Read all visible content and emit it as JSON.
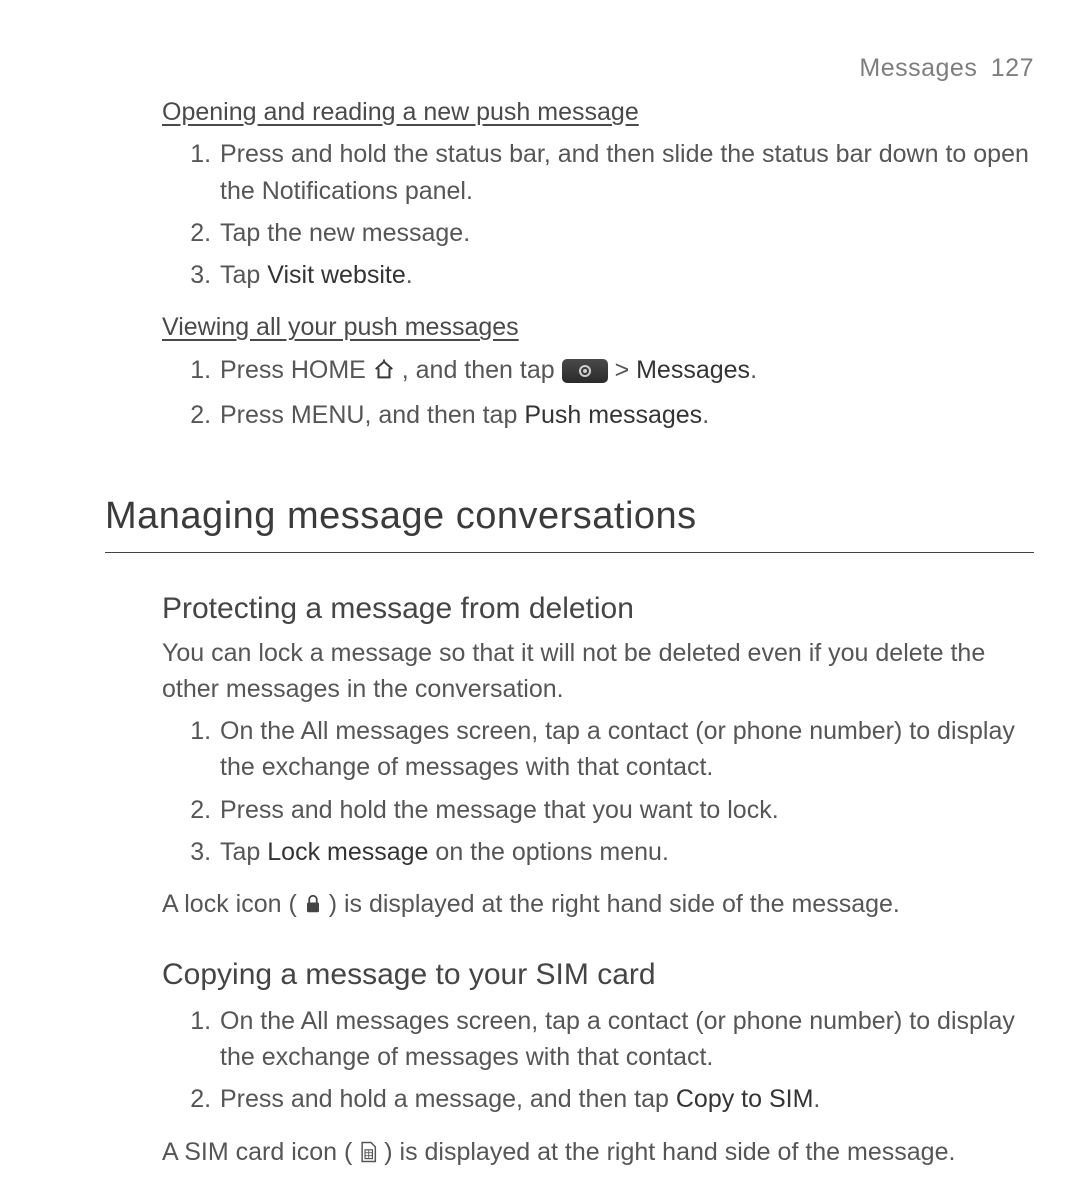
{
  "header": {
    "section": "Messages",
    "page_number": "127"
  },
  "sec1": {
    "sub1": "Opening and reading a new push message",
    "s1_1": "Press and hold the status bar, and then slide the status bar down to open the Notifications panel.",
    "s1_2": "Tap the new message.",
    "s1_3_a": "Tap ",
    "s1_3_b": "Visit website",
    "s1_3_c": ".",
    "sub2": "Viewing all your push messages",
    "s2_1_a": "Press HOME ",
    "s2_1_b": ", and then tap ",
    "s2_1_c": "  > ",
    "s2_1_d": "Messages",
    "s2_1_e": ".",
    "s2_2_a": "Press MENU, and then tap ",
    "s2_2_b": "Push messages",
    "s2_2_c": "."
  },
  "h1": "Managing message conversations",
  "sec2": {
    "h2a": "Protecting a message from deletion",
    "p_a": "You can lock a message so that it will not be deleted even if you delete the other messages in the conversation.",
    "a1": "On the All messages screen, tap a contact (or phone number) to display the exchange of messages with that contact.",
    "a2": "Press and hold the message that you want to lock.",
    "a3_a": "Tap ",
    "a3_b": "Lock message",
    "a3_c": " on the options menu.",
    "p_b_a": "A lock icon ( ",
    "p_b_b": " ) is displayed at the right hand side of the message.",
    "h2b": "Copying a message to your SIM card",
    "b1": "On the All messages screen, tap a contact (or phone number) to display the exchange of messages with that contact.",
    "b2_a": "Press and hold a message, and then tap ",
    "b2_b": "Copy to SIM",
    "b2_c": ".",
    "p_c_a": "A SIM card icon ( ",
    "p_c_b": " ) is displayed at the right hand side of the message."
  }
}
